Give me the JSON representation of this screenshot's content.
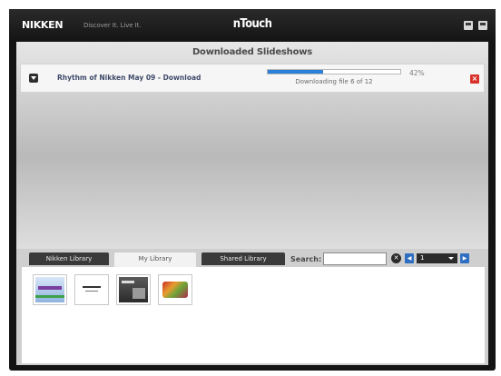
{
  "titlebar": {
    "brand": "NIKKEN",
    "tagline": "Discover It. Live It.",
    "app_title": "nTouch",
    "controls": [
      "minimize-icon",
      "maximize-icon"
    ]
  },
  "downloads": {
    "header": "Downloaded Slideshows",
    "items": [
      {
        "title": "Rhythm of Nikken May 09 - Download",
        "status": "Downloading file 6 of 12",
        "percent_label": "42%",
        "progress": 0.42
      }
    ]
  },
  "library": {
    "tabs": [
      {
        "label": "Nikken Library",
        "active": false
      },
      {
        "label": "My Library",
        "active": true
      },
      {
        "label": "Shared Library",
        "active": false
      }
    ],
    "search": {
      "label": "Search:",
      "value": "",
      "placeholder": ""
    },
    "page": {
      "current": "1"
    },
    "thumbnails": [
      "slide-thumbnail-1",
      "slide-thumbnail-2",
      "slide-thumbnail-3",
      "slide-thumbnail-4"
    ]
  },
  "colors": {
    "accent": "#2b7fd6",
    "cancel": "#d8312a",
    "window": "#141414"
  }
}
